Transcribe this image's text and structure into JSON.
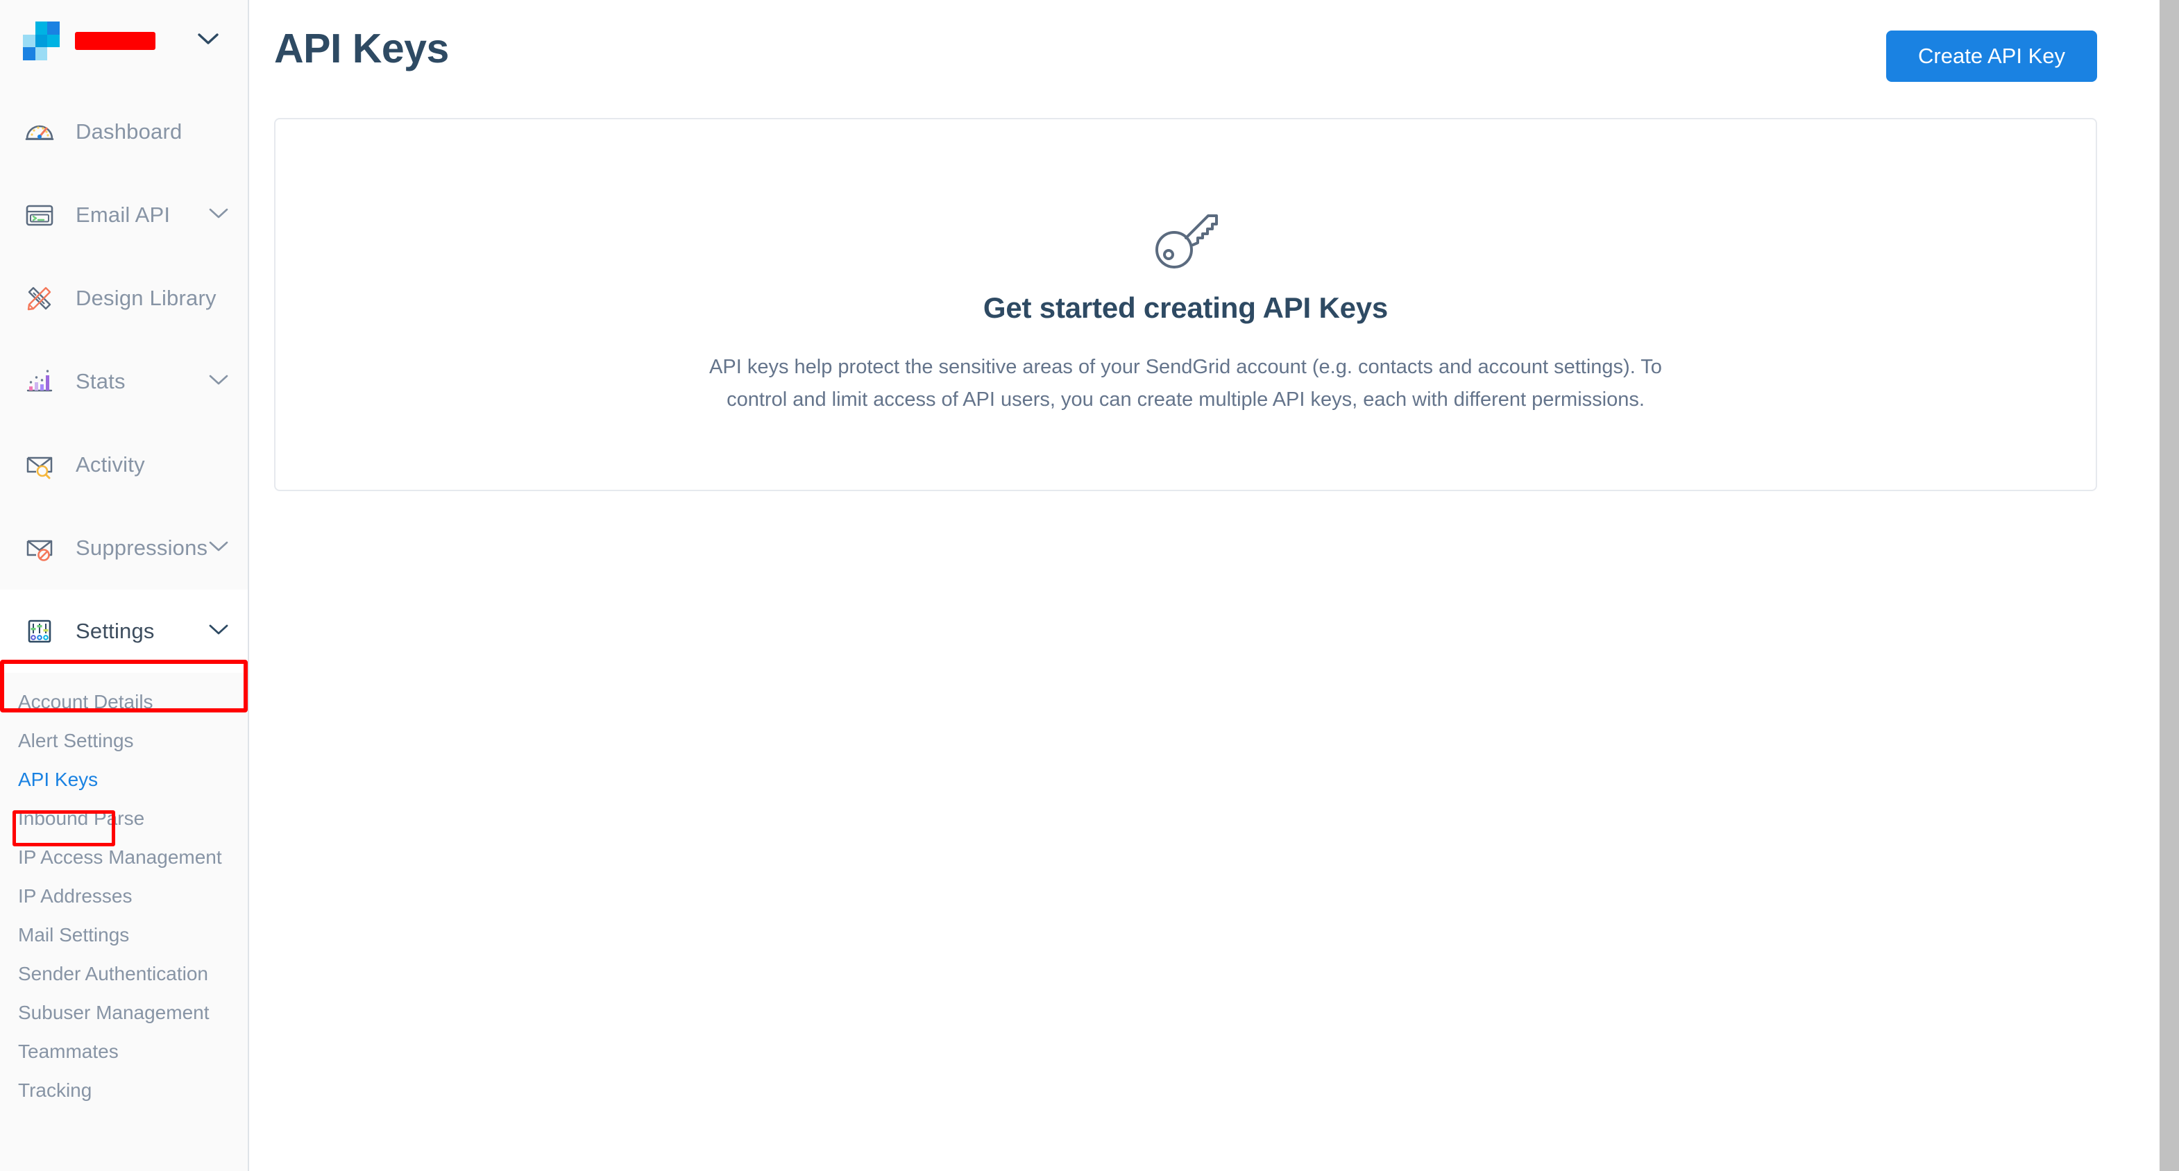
{
  "sidebar": {
    "brand": {
      "logo_name": "sendgrid-logo",
      "account_name_redacted": "",
      "chevron": "chevron-down-icon",
      "logo_colors": [
        "#00b3e3",
        "#1a82e2",
        "#9adcf5",
        "#009ddc",
        "#00b3e3",
        "#1a82e2",
        "#9adcf5"
      ]
    },
    "nav_items": [
      {
        "label": "Dashboard",
        "icon": "gauge-icon",
        "expandable": false
      },
      {
        "label": "Email API",
        "icon": "terminal-card-icon",
        "expandable": true
      },
      {
        "label": "Design Library",
        "icon": "pencil-ruler-icon",
        "expandable": false
      },
      {
        "label": "Stats",
        "icon": "bar-chart-icon",
        "expandable": true
      },
      {
        "label": "Activity",
        "icon": "envelope-search-icon",
        "expandable": false
      },
      {
        "label": "Suppressions",
        "icon": "envelope-blocked-icon",
        "expandable": true
      },
      {
        "label": "Settings",
        "icon": "sliders-icon",
        "expandable": true
      }
    ],
    "sub_items": [
      {
        "label": "Account Details",
        "selected": false
      },
      {
        "label": "Alert Settings",
        "selected": false
      },
      {
        "label": "API Keys",
        "selected": true
      },
      {
        "label": "Inbound Parse",
        "selected": false
      },
      {
        "label": "IP Access Management",
        "selected": false
      },
      {
        "label": "IP Addresses",
        "selected": false
      },
      {
        "label": "Mail Settings",
        "selected": false
      },
      {
        "label": "Sender Authentication",
        "selected": false
      },
      {
        "label": "Subuser Management",
        "selected": false
      },
      {
        "label": "Teammates",
        "selected": false
      },
      {
        "label": "Tracking",
        "selected": false
      }
    ]
  },
  "main": {
    "page_title": "API Keys",
    "create_button_label": "Create API Key",
    "empty_state": {
      "icon": "key-icon",
      "title": "Get started creating API Keys",
      "description": "API keys help protect the sensitive areas of your SendGrid account (e.g. contacts and account settings). To control and limit access of API users, you can create multiple API keys, each with different permissions."
    }
  },
  "colors": {
    "accent_blue": "#1a82e2",
    "title_navy": "#2e4a63",
    "muted_text": "#8794a5",
    "body_text": "#64748b",
    "highlight_red": "#ff0000",
    "sidebar_bg": "#fafafa",
    "card_border": "#e6e9ee"
  }
}
